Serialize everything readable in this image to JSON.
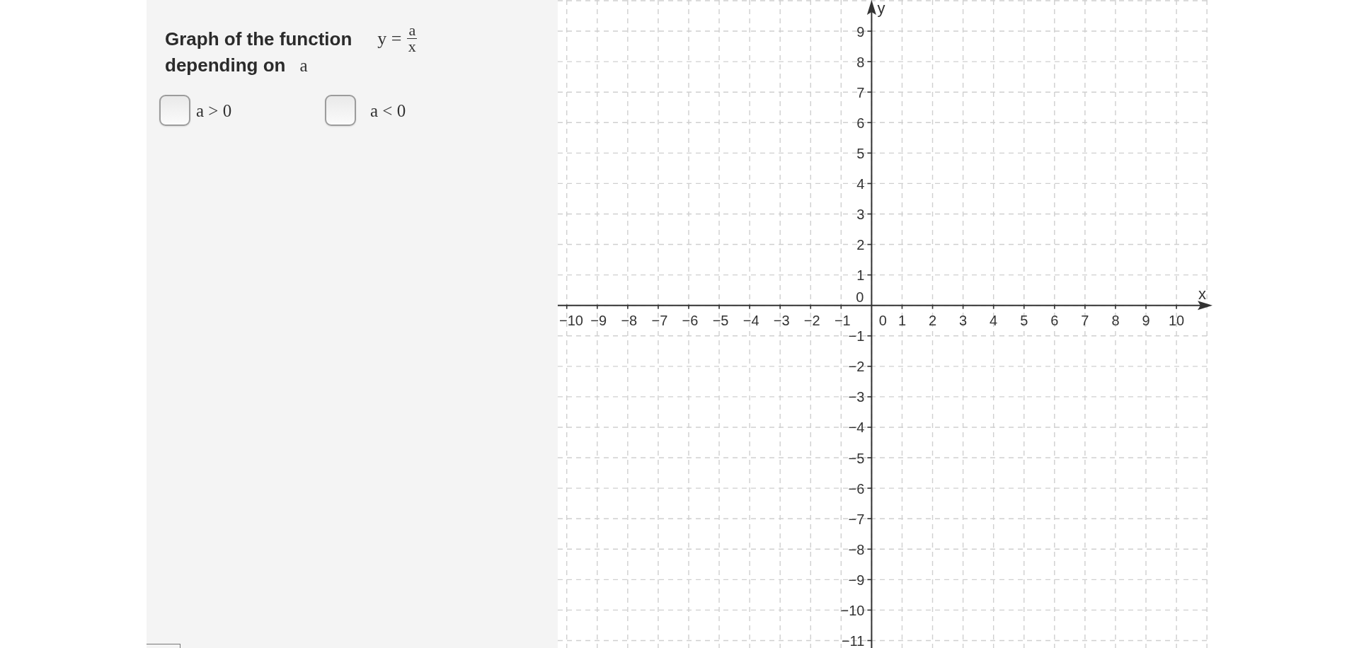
{
  "panel": {
    "title": "Graph of the function",
    "formula": {
      "left": "y =",
      "numerator": "a",
      "denominator": "x"
    },
    "subtitle": "depending on",
    "parameter": "a",
    "checkboxes": [
      {
        "label": "a > 0",
        "checked": false
      },
      {
        "label": "a < 0",
        "checked": false
      }
    ]
  },
  "graph": {
    "x_axis": {
      "label": "x",
      "negative_ticks": [
        "−10",
        "−9",
        "−8",
        "−7",
        "−6",
        "−5",
        "−4",
        "−3",
        "−2",
        "−1"
      ],
      "origin_tick": "0",
      "positive_ticks": [
        "1",
        "2",
        "3",
        "4",
        "5",
        "6",
        "7",
        "8",
        "9",
        "10"
      ]
    },
    "y_axis": {
      "label": "y",
      "positive_ticks": [
        "9",
        "8",
        "7",
        "6",
        "5",
        "4",
        "3",
        "2",
        "1"
      ],
      "origin_tick": "0",
      "negative_ticks": [
        "−1",
        "−2",
        "−3",
        "−4",
        "−5",
        "−6",
        "−7",
        "−8",
        "−9",
        "−10",
        "−11"
      ]
    }
  }
}
